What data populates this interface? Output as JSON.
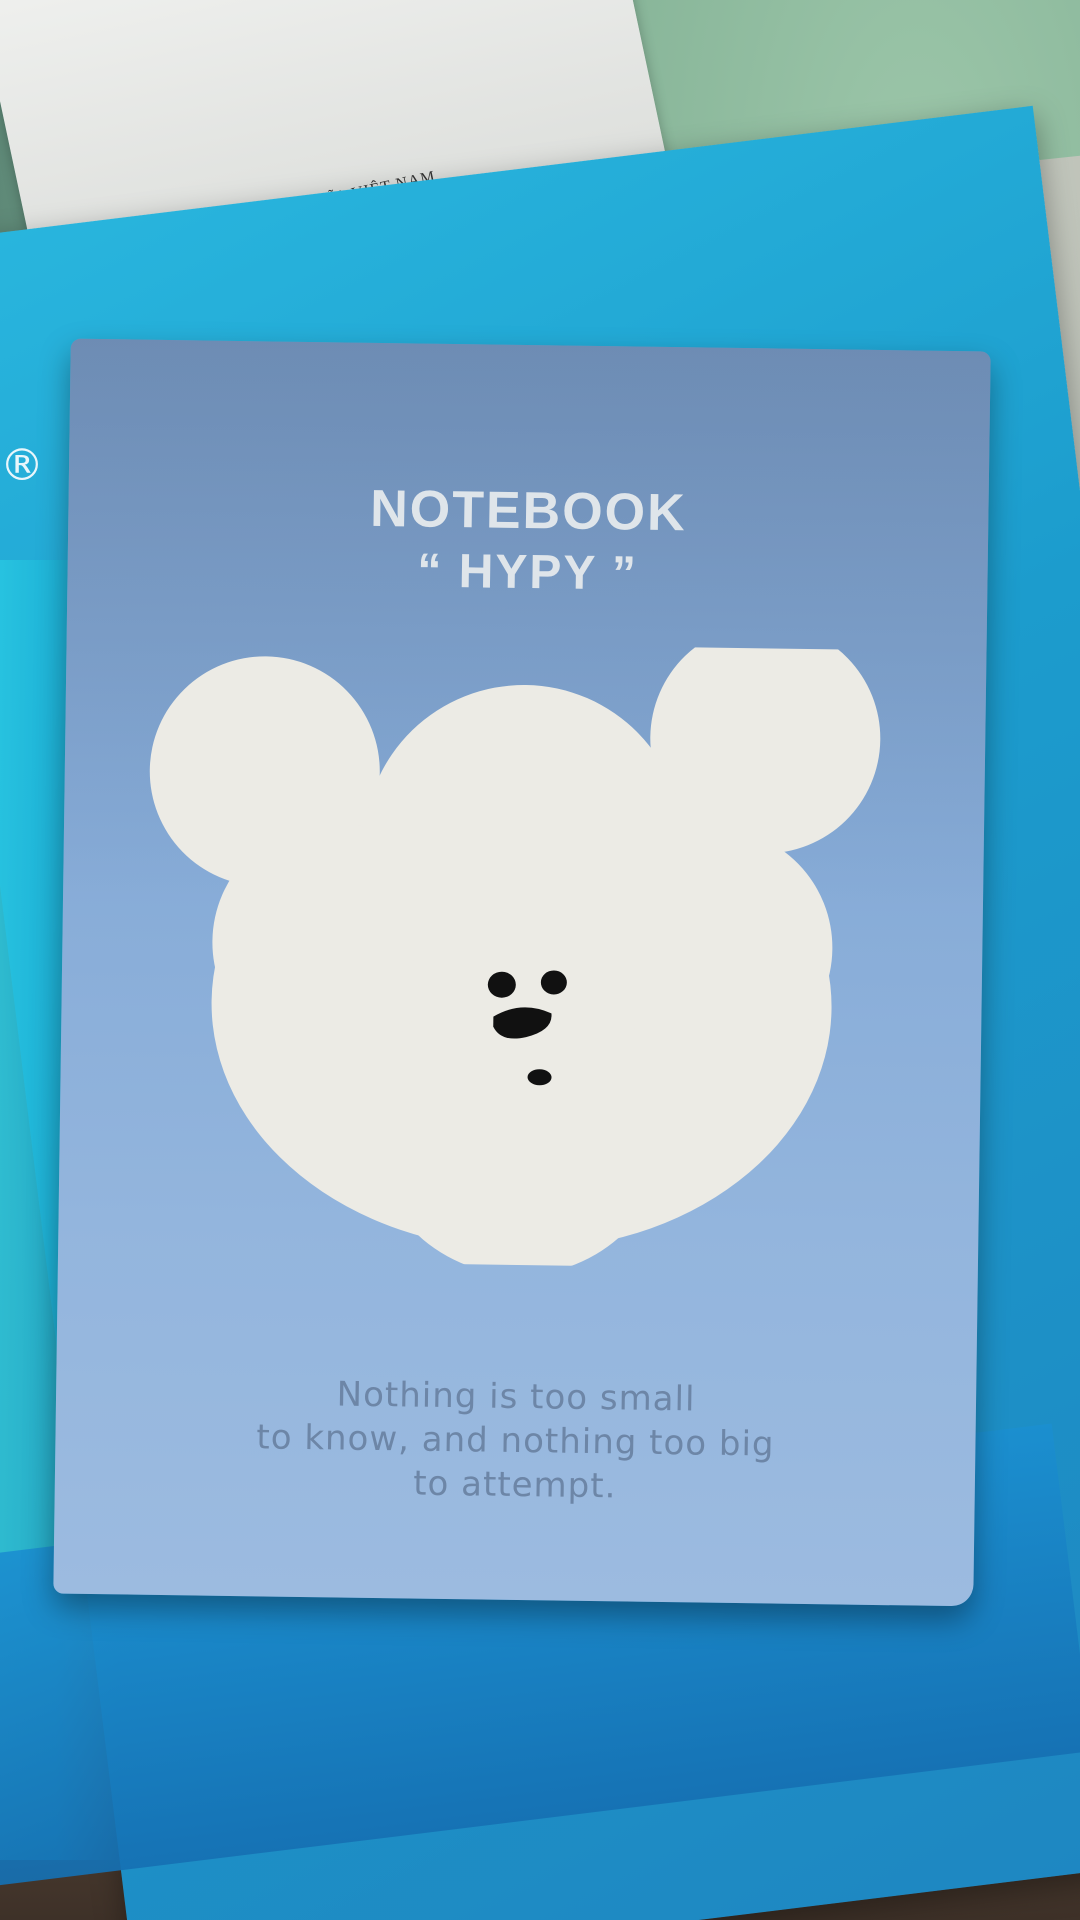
{
  "paper": {
    "text": "CỘNG HÒA XÃ HỘI CHỦ NGHĨA VIỆT NAM"
  },
  "folder": {
    "edge_mark": "®"
  },
  "notebook": {
    "title": "NOTEBOOK",
    "subtitle": "“ HYPY ”",
    "quote_lines": [
      "Nothing is too small",
      "to know, and nothing too big",
      "to attempt."
    ]
  },
  "colors": {
    "cover_blue": "#86abd7",
    "folder_blue": "#1c9ccd",
    "bear_white": "#ecebe5",
    "quote_text": "#6d86a7"
  },
  "icons": [
    "bear-face-illustration"
  ]
}
